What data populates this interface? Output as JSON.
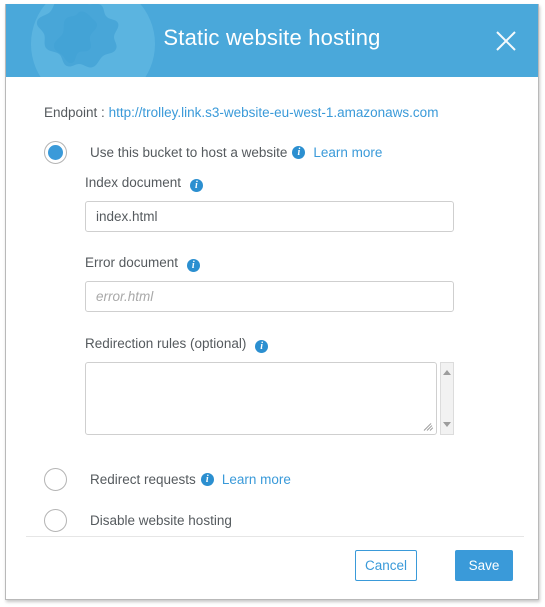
{
  "dialog": {
    "title": "Static website hosting",
    "close_icon": "close-icon"
  },
  "endpoint": {
    "label": "Endpoint :",
    "url": "http://trolley.link.s3-website-eu-west-1.amazonaws.com"
  },
  "options": [
    {
      "id": "use-bucket",
      "label": "Use this bucket to host a website",
      "selected": true,
      "has_info": true,
      "learn_more": "Learn more"
    },
    {
      "id": "redirect-requests",
      "label": "Redirect requests",
      "selected": false,
      "has_info": true,
      "learn_more": "Learn more"
    },
    {
      "id": "disable-hosting",
      "label": "Disable website hosting",
      "selected": false,
      "has_info": false,
      "learn_more": ""
    }
  ],
  "fields": {
    "index_document": {
      "label": "Index document",
      "value": "index.html",
      "placeholder": "index.html"
    },
    "error_document": {
      "label": "Error document",
      "value": "",
      "placeholder": "error.html"
    },
    "redirection_rules": {
      "label": "Redirection rules (optional)",
      "value": "",
      "placeholder": ""
    }
  },
  "footer": {
    "cancel_label": "Cancel",
    "save_label": "Save"
  },
  "colors": {
    "header_blue": "#4aa8da",
    "accent_blue": "#3a9ad9",
    "info_blue": "#2b8fd0",
    "text_grey": "#555a5e"
  }
}
